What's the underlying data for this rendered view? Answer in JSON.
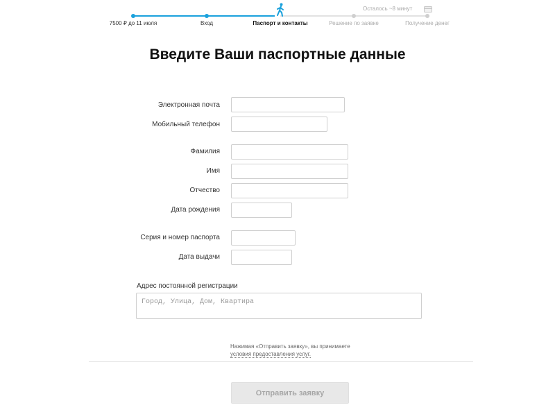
{
  "stepper": {
    "steps": [
      {
        "label": "7500 ₽ до 11 июля",
        "state": "done"
      },
      {
        "label": "Вход",
        "state": "done"
      },
      {
        "label": "Паспорт и контакты",
        "state": "current"
      },
      {
        "label": "Решение по заявке",
        "state": "todo"
      },
      {
        "label": "Получение денег",
        "state": "todo"
      }
    ],
    "remaining": "Осталось ~8 минут",
    "accent_color": "#1aa1dc"
  },
  "title": "Введите Ваши паспортные данные",
  "form": {
    "email_label": "Электронная почта",
    "email_value": "",
    "phone_label": "Мобильный телефон",
    "phone_value": "",
    "surname_label": "Фамилия",
    "surname_value": "",
    "name_label": "Имя",
    "name_value": "",
    "patronymic_label": "Отчество",
    "patronymic_value": "",
    "birthdate_label": "Дата рождения",
    "birthdate_value": "",
    "passport_label": "Серия и номер паспорта",
    "passport_value": "",
    "issue_date_label": "Дата выдачи",
    "issue_date_value": "",
    "address_label": "Адрес постоянной регистрации",
    "address_placeholder": "Город, Улица, Дом, Квартира"
  },
  "consent": {
    "text": "Нажимая «Отправить заявку», вы принимаете",
    "link_text": "условия предоставления услуг."
  },
  "submit_label": "Отправить заявку",
  "icons": {
    "current_step": "walker-icon",
    "payout": "card-icon"
  }
}
